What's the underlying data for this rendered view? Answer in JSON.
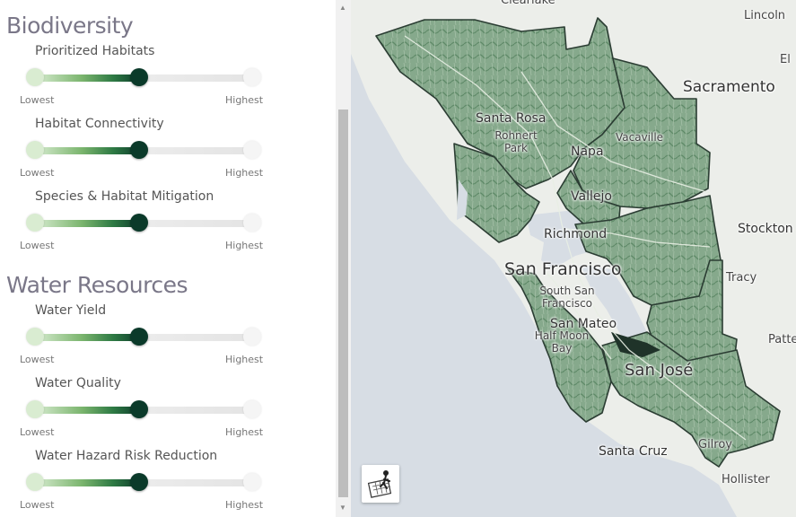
{
  "sections": [
    {
      "title": "Biodiversity",
      "sliders": [
        {
          "label": "Prioritized Habitats",
          "low": "Lowest",
          "high": "Highest",
          "value": 0.5
        },
        {
          "label": "Habitat Connectivity",
          "low": "Lowest",
          "high": "Highest",
          "value": 0.5
        },
        {
          "label": "Species & Habitat Mitigation",
          "low": "Lowest",
          "high": "Highest",
          "value": 0.5
        }
      ]
    },
    {
      "title": "Water Resources",
      "sliders": [
        {
          "label": "Water Yield",
          "low": "Lowest",
          "high": "Highest",
          "value": 0.5
        },
        {
          "label": "Water Quality",
          "low": "Lowest",
          "high": "Highest",
          "value": 0.5
        },
        {
          "label": "Water Hazard Risk Reduction",
          "low": "Lowest",
          "high": "Highest",
          "value": 0.5
        }
      ]
    }
  ],
  "map": {
    "cities": {
      "clearlake": "Clearlake",
      "lincoln": "Lincoln",
      "el": "El",
      "sacramento": "Sacramento",
      "santa_rosa": "Santa Rosa",
      "rohnert_park": "Rohnert Park",
      "napa": "Napa",
      "vacaville": "Vacaville",
      "vallejo": "Vallejo",
      "stockton": "Stockton",
      "richmond": "Richmond",
      "san_francisco": "San Francisco",
      "tracy": "Tracy",
      "south_sf": "South San Francisco",
      "san_mateo": "San Mateo",
      "half_moon_bay": "Half Moon Bay",
      "san_jose": "San José",
      "patte": "Patte",
      "santa_cruz": "Santa Cruz",
      "gilroy": "Gilroy",
      "hollister": "Hollister"
    },
    "colors": {
      "water": "#d7dde4",
      "land": "#eceeea",
      "region": "#7fa486",
      "region_dark": "#4f7f5a",
      "border": "#2b3d33"
    }
  }
}
